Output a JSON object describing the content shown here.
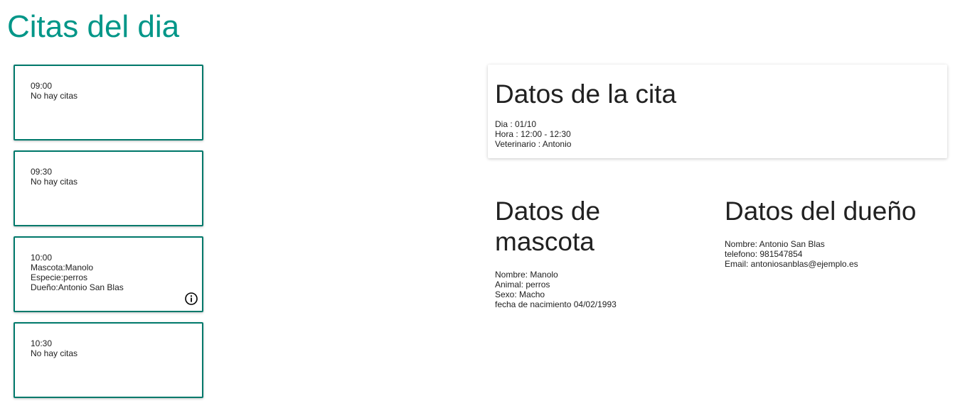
{
  "page": {
    "title": "Citas del dia"
  },
  "slots": [
    {
      "time": "09:00",
      "lines": [
        "No hay citas"
      ]
    },
    {
      "time": "09:30",
      "lines": [
        "No hay citas"
      ]
    },
    {
      "time": "10:00",
      "lines": [
        "Mascota:Manolo",
        "Especie:perros",
        "Dueño:Antonio San Blas"
      ],
      "has_info": true
    },
    {
      "time": "10:30",
      "lines": [
        "No hay citas"
      ]
    }
  ],
  "cita": {
    "heading": "Datos de la cita",
    "dia": "Dia : 01/10",
    "hora": "Hora : 12:00 - 12:30",
    "veterinario": "Veterinario : Antonio"
  },
  "mascota": {
    "heading_line1": "Datos de",
    "heading_line2": "mascota",
    "nombre": "Nombre: Manolo",
    "animal": "Animal: perros",
    "sexo": "Sexo: Macho",
    "nacimiento": "fecha de nacimiento 04/02/1993"
  },
  "dueno": {
    "heading": "Datos del dueño",
    "nombre": "Nombre: Antonio San Blas",
    "telefono": "telefono: 981547854",
    "email": "Email: antoniosanblas@ejemplo.es"
  },
  "colors": {
    "accent": "#009688",
    "card_border": "#00796b"
  },
  "icons": {
    "info": "info-circle-icon"
  }
}
